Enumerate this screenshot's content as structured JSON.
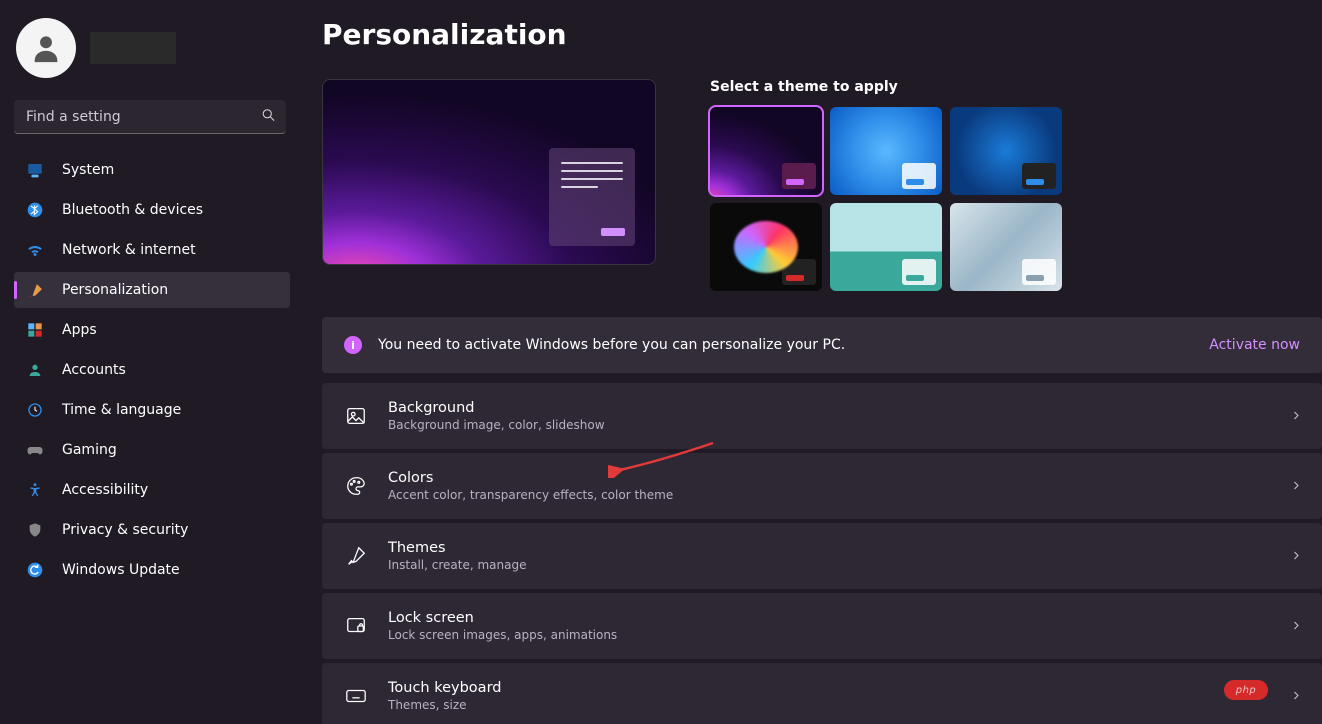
{
  "search": {
    "placeholder": "Find a setting"
  },
  "nav": {
    "items": [
      {
        "label": "System",
        "icon": "🖥️"
      },
      {
        "label": "Bluetooth & devices",
        "icon": "bt"
      },
      {
        "label": "Network & internet",
        "icon": "📶"
      },
      {
        "label": "Personalization",
        "icon": "🖌️"
      },
      {
        "label": "Apps",
        "icon": "app"
      },
      {
        "label": "Accounts",
        "icon": "👤"
      },
      {
        "label": "Time & language",
        "icon": "🕒"
      },
      {
        "label": "Gaming",
        "icon": "🎮"
      },
      {
        "label": "Accessibility",
        "icon": "acc"
      },
      {
        "label": "Privacy & security",
        "icon": "🛡️"
      },
      {
        "label": "Windows Update",
        "icon": "🔄"
      }
    ],
    "activeIndex": 3
  },
  "page": {
    "title": "Personalization",
    "themeLabel": "Select a theme to apply",
    "activation": {
      "message": "You need to activate Windows before you can personalize your PC.",
      "action": "Activate now"
    },
    "themes": [
      {
        "name": "Windows dark purple (selected)",
        "selected": true,
        "chip": "dark",
        "chipBar": "#d265ff"
      },
      {
        "name": "Windows light blue",
        "selected": false,
        "chip": "light",
        "chipBar": "#2e8de8"
      },
      {
        "name": "Windows dark blue",
        "selected": false,
        "chip": "dark2",
        "chipBar": "#2e8de8"
      },
      {
        "name": "Flower dark",
        "selected": false,
        "chip": "dark2",
        "chipBar": "#d62a2a"
      },
      {
        "name": "Beach light",
        "selected": false,
        "chip": "light",
        "chipBar": "#3aa89a"
      },
      {
        "name": "Flow light",
        "selected": false,
        "chip": "light",
        "chipBar": "#8aa0b0"
      }
    ],
    "options": [
      {
        "key": "background",
        "title": "Background",
        "desc": "Background image, color, slideshow"
      },
      {
        "key": "colors",
        "title": "Colors",
        "desc": "Accent color, transparency effects, color theme"
      },
      {
        "key": "themes",
        "title": "Themes",
        "desc": "Install, create, manage"
      },
      {
        "key": "lock-screen",
        "title": "Lock screen",
        "desc": "Lock screen images, apps, animations"
      },
      {
        "key": "touch-keyboard",
        "title": "Touch keyboard",
        "desc": "Themes, size"
      }
    ]
  },
  "badge": {
    "text": "php"
  },
  "colors": {
    "accent": "#d265ff",
    "link": "#d48fff"
  }
}
